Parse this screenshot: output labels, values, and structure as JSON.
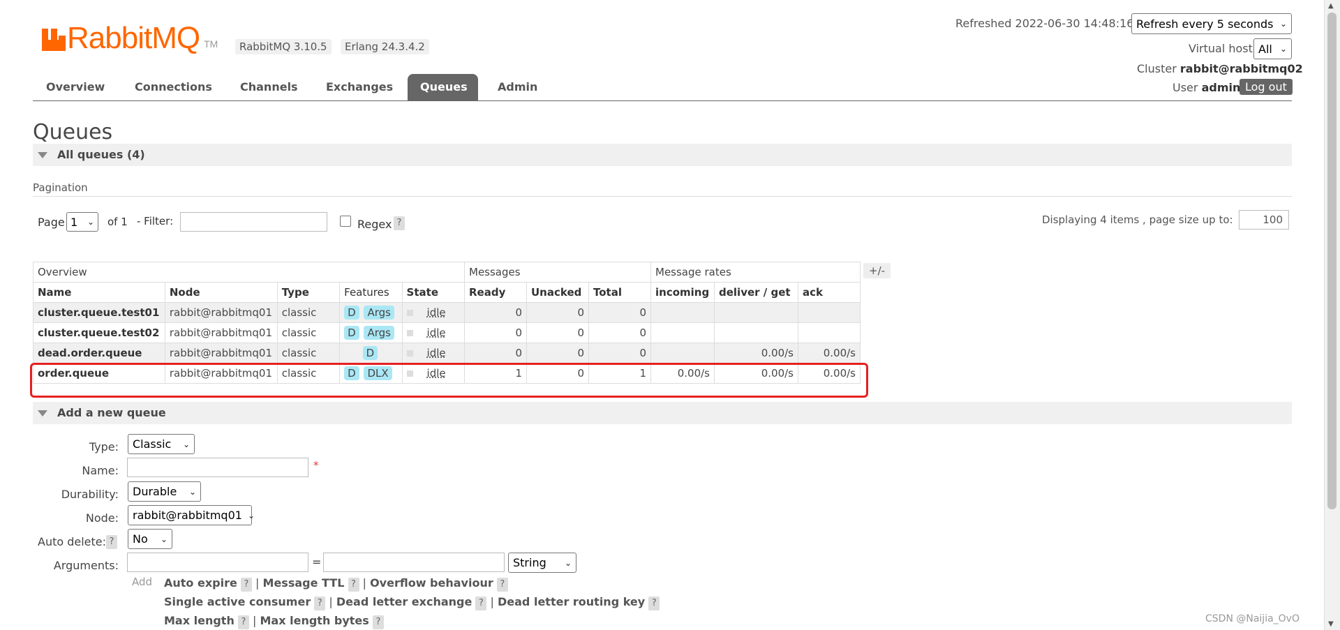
{
  "app": {
    "logo_text": "RabbitMQ",
    "logo_tm": "TM",
    "versions": [
      "RabbitMQ 3.10.5",
      "Erlang 24.3.4.2"
    ]
  },
  "header": {
    "refreshed_label": "Refreshed 2022-06-30 14:48:16",
    "refresh_select": "Refresh every 5 seconds",
    "vhost_label": "Virtual host",
    "vhost_select": "All",
    "cluster_label": "Cluster",
    "cluster_name": "rabbit@rabbitmq02",
    "user_label": "User",
    "user_name": "admin",
    "logout": "Log out"
  },
  "nav": {
    "tabs": [
      "Overview",
      "Connections",
      "Channels",
      "Exchanges",
      "Queues",
      "Admin"
    ],
    "active": "Queues"
  },
  "page": {
    "title": "Queues",
    "all_queues": "All queues (4)",
    "pagination_label": "Pagination",
    "page_label": "Page",
    "page_value": "1",
    "of_label": "of 1",
    "filter_label": "- Filter:",
    "filter_value": "",
    "regex_label": "Regex",
    "help": "?",
    "display_info": "Displaying 4 items , page size up to:",
    "page_size": "100",
    "plus_minus": "+/-"
  },
  "table": {
    "groups": [
      "Overview",
      "Messages",
      "Message rates"
    ],
    "columns": [
      "Name",
      "Node",
      "Type",
      "Features",
      "State",
      "Ready",
      "Unacked",
      "Total",
      "incoming",
      "deliver / get",
      "ack"
    ],
    "rows": [
      {
        "name": "cluster.queue.test01",
        "node": "rabbit@rabbitmq01",
        "type": "classic",
        "features": [
          "D",
          "Args"
        ],
        "state": "idle",
        "ready": "0",
        "unacked": "0",
        "total": "0",
        "incoming": "",
        "deliver": "",
        "ack": ""
      },
      {
        "name": "cluster.queue.test02",
        "node": "rabbit@rabbitmq01",
        "type": "classic",
        "features": [
          "D",
          "Args"
        ],
        "state": "idle",
        "ready": "0",
        "unacked": "0",
        "total": "0",
        "incoming": "",
        "deliver": "",
        "ack": ""
      },
      {
        "name": "dead.order.queue",
        "node": "rabbit@rabbitmq01",
        "type": "classic",
        "features": [
          "D"
        ],
        "state": "idle",
        "ready": "0",
        "unacked": "0",
        "total": "0",
        "incoming": "",
        "deliver": "0.00/s",
        "ack": "0.00/s"
      },
      {
        "name": "order.queue",
        "node": "rabbit@rabbitmq01",
        "type": "classic",
        "features": [
          "D",
          "DLX"
        ],
        "state": "idle",
        "ready": "1",
        "unacked": "0",
        "total": "1",
        "incoming": "0.00/s",
        "deliver": "0.00/s",
        "ack": "0.00/s"
      }
    ]
  },
  "add_queue": {
    "title": "Add a new queue",
    "type_label": "Type:",
    "type_value": "Classic",
    "name_label": "Name:",
    "name_value": "",
    "required": "*",
    "durability_label": "Durability:",
    "durability_value": "Durable",
    "node_label": "Node:",
    "node_value": "rabbit@rabbitmq01",
    "auto_delete_label": "Auto delete:",
    "auto_delete_value": "No",
    "arguments_label": "Arguments:",
    "equals": "=",
    "arg_type": "String",
    "add_label": "Add",
    "arg_links": [
      [
        "Auto expire",
        "Message TTL",
        "Overflow behaviour"
      ],
      [
        "Single active consumer",
        "Dead letter exchange",
        "Dead letter routing key"
      ],
      [
        "Max length",
        "Max length bytes"
      ]
    ],
    "separator": "|"
  },
  "watermark": "CSDN @Naijia_OvO"
}
